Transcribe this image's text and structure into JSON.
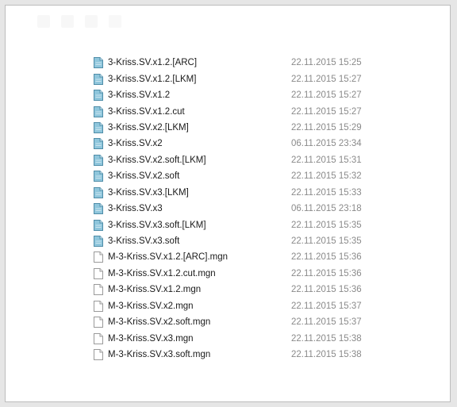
{
  "files": [
    {
      "name": "3-Kriss.SV.x1.2.[ARC]",
      "date": "22.11.2015 15:25",
      "icon": "database-file-icon"
    },
    {
      "name": "3-Kriss.SV.x1.2.[LKM]",
      "date": "22.11.2015 15:27",
      "icon": "database-file-icon"
    },
    {
      "name": "3-Kriss.SV.x1.2",
      "date": "22.11.2015 15:27",
      "icon": "database-file-icon"
    },
    {
      "name": "3-Kriss.SV.x1.2.cut",
      "date": "22.11.2015 15:27",
      "icon": "database-file-icon"
    },
    {
      "name": "3-Kriss.SV.x2.[LKM]",
      "date": "22.11.2015 15:29",
      "icon": "database-file-icon"
    },
    {
      "name": "3-Kriss.SV.x2",
      "date": "06.11.2015 23:34",
      "icon": "database-file-icon"
    },
    {
      "name": "3-Kriss.SV.x2.soft.[LKM]",
      "date": "22.11.2015 15:31",
      "icon": "database-file-icon"
    },
    {
      "name": "3-Kriss.SV.x2.soft",
      "date": "22.11.2015 15:32",
      "icon": "database-file-icon"
    },
    {
      "name": "3-Kriss.SV.x3.[LKM]",
      "date": "22.11.2015 15:33",
      "icon": "database-file-icon"
    },
    {
      "name": "3-Kriss.SV.x3",
      "date": "06.11.2015 23:18",
      "icon": "database-file-icon"
    },
    {
      "name": "3-Kriss.SV.x3.soft.[LKM]",
      "date": "22.11.2015 15:35",
      "icon": "database-file-icon"
    },
    {
      "name": "3-Kriss.SV.x3.soft",
      "date": "22.11.2015 15:35",
      "icon": "database-file-icon"
    },
    {
      "name": "M-3-Kriss.SV.x1.2.[ARC].mgn",
      "date": "22.11.2015 15:36",
      "icon": "blank-file-icon"
    },
    {
      "name": "M-3-Kriss.SV.x1.2.cut.mgn",
      "date": "22.11.2015 15:36",
      "icon": "blank-file-icon"
    },
    {
      "name": "M-3-Kriss.SV.x1.2.mgn",
      "date": "22.11.2015 15:36",
      "icon": "blank-file-icon"
    },
    {
      "name": "M-3-Kriss.SV.x2.mgn",
      "date": "22.11.2015 15:37",
      "icon": "blank-file-icon"
    },
    {
      "name": "M-3-Kriss.SV.x2.soft.mgn",
      "date": "22.11.2015 15:37",
      "icon": "blank-file-icon"
    },
    {
      "name": "M-3-Kriss.SV.x3.mgn",
      "date": "22.11.2015 15:38",
      "icon": "blank-file-icon"
    },
    {
      "name": "M-3-Kriss.SV.x3.soft.mgn",
      "date": "22.11.2015 15:38",
      "icon": "blank-file-icon"
    }
  ],
  "colors": {
    "database_icon_fill": "#8fc6dc",
    "database_icon_stroke": "#4f8da8",
    "blank_icon_stroke": "#9a9a9a",
    "date_text": "#8a8a8a"
  }
}
